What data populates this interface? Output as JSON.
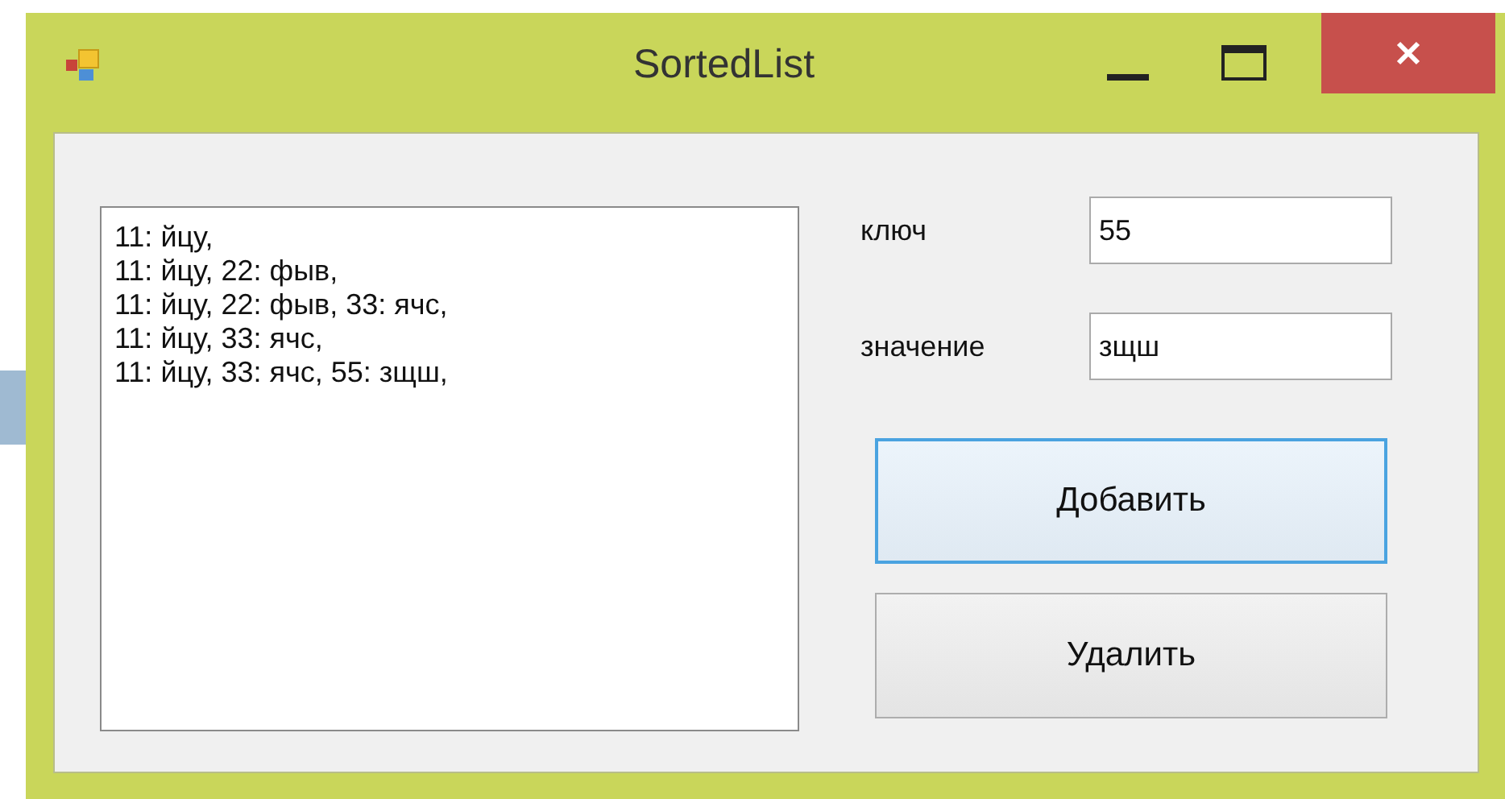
{
  "window": {
    "title": "SortedList"
  },
  "list": {
    "lines": [
      "11: йцу,",
      "11: йцу, 22: фыв,",
      "11: йцу, 22: фыв, 33: ячс,",
      "11: йцу, 33: ячс,",
      "11: йцу, 33: ячс, 55: зщш,"
    ]
  },
  "fields": [
    {
      "label": "ключ",
      "value": "55"
    },
    {
      "label": "значение",
      "value": "зщш"
    }
  ],
  "buttons": [
    {
      "label": "Добавить",
      "focused": true
    },
    {
      "label": "Удалить",
      "focused": false
    }
  ]
}
